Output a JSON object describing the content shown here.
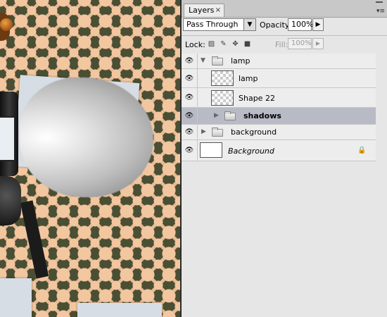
{
  "panel": {
    "tab_label": "Layers",
    "tab_close": "×",
    "blend_mode": "Pass Through",
    "opacity_label": "Opacity:",
    "opacity_value": "100%",
    "lock_label": "Lock:",
    "fill_label": "Fill:",
    "fill_value": "100%"
  },
  "layers": [
    {
      "name": "lamp",
      "type": "group",
      "expanded": true,
      "visible": true
    },
    {
      "name": "lamp",
      "type": "layer",
      "visible": true
    },
    {
      "name": "Shape 22",
      "type": "layer",
      "visible": true
    },
    {
      "name": "shadows",
      "type": "group",
      "expanded": false,
      "visible": true,
      "selected": true
    },
    {
      "name": "background",
      "type": "group",
      "expanded": false,
      "visible": true
    },
    {
      "name": "Background",
      "type": "layer",
      "visible": true,
      "locked": true
    }
  ],
  "icons": {
    "eye": "eye-icon",
    "folder": "folder-icon",
    "lock": "lock-icon",
    "expand": "triangle-icon"
  }
}
